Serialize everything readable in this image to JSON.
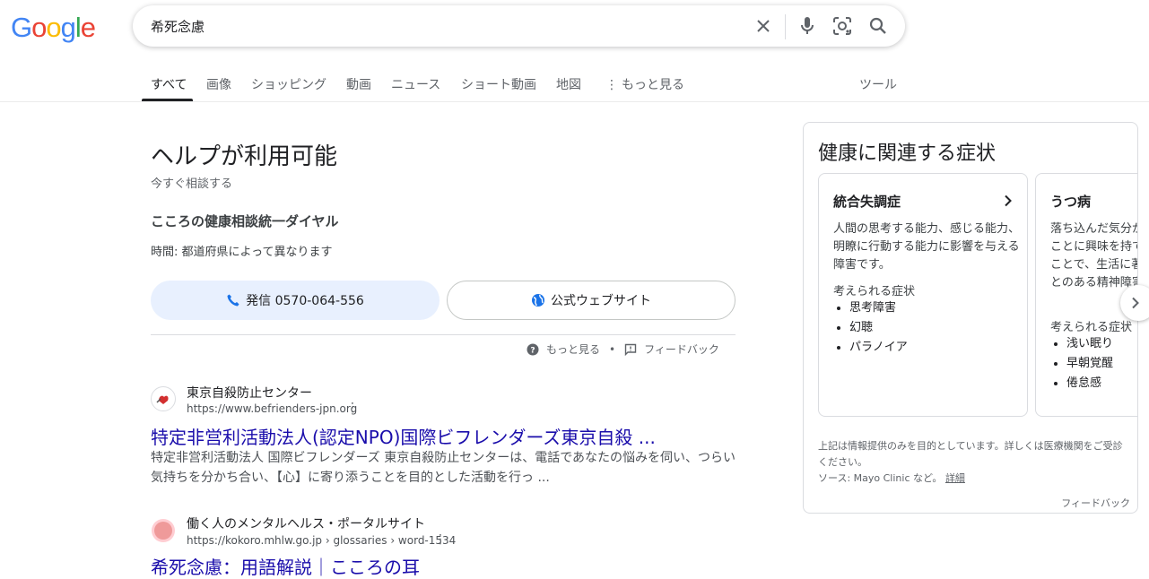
{
  "logo": {
    "letters": [
      "G",
      "o",
      "o",
      "g",
      "l",
      "e"
    ],
    "colors": [
      "#4285f4",
      "#ea4335",
      "#fbbc05",
      "#4285f4",
      "#34a853",
      "#ea4335"
    ]
  },
  "search": {
    "query": "希死念慮"
  },
  "tabs": [
    "すべて",
    "画像",
    "ショッピング",
    "動画",
    "ニュース",
    "ショート動画",
    "地図",
    "もっと見る",
    "ツール"
  ],
  "help": {
    "title": "ヘルプが利用可能",
    "subtitle": "今すぐ相談する",
    "hotline": "こころの健康相談統一ダイヤル",
    "hours_label": "時間",
    "hours_value": ": 都道府県によって異なります",
    "call_label": "発信 0570-064-556",
    "web_label": "公式ウェブサイト",
    "more_label": "もっと見る",
    "feedback_label": "フィードバック",
    "accent": "#1a73e8"
  },
  "results": [
    {
      "site": "東京自殺防止センター",
      "url": "https://www.befrienders-jpn.org",
      "title": "特定非営利活動法人(認定NPO)国際ビフレンダーズ東京自殺 ...",
      "snippet": "特定非営利活動法人 国際ビフレンダーズ 東京自殺防止センターは、電話であなたの悩みを伺い、つらい気持ちを分かち合い、【心】に寄り添うことを目的とした活動を行っ ..."
    },
    {
      "site": "働く人のメンタルヘルス・ポータルサイト",
      "url": "https://kokoro.mhlw.go.jp › glossaries › word-1534",
      "title": "希死念慮：用語解説｜こころの耳"
    }
  ],
  "knowledge_panel": {
    "title": "健康に関連する症状",
    "cards": [
      {
        "title": "統合失調症",
        "description": "人間の思考する能力、感じる能力、明瞭に行動する能力に影響を与える障害です。",
        "symptoms_label": "考えられる症状",
        "symptoms": [
          "思考障害",
          "幻聴",
          "パラノイア"
        ]
      },
      {
        "title": "うつ病",
        "description": "落ち込んだ気分が続き、身の回りのことに興味を持てなくなったりすることで、生活に著しい支障が出ることのある精神障害",
        "symptoms_label": "考えられる症状",
        "symptoms": [
          "浅い眠り",
          "早朝覚醒",
          "倦怠感"
        ]
      }
    ],
    "note": "上記は情報提供のみを目的としています。詳しくは医療機関をご受診ください。",
    "source": "ソース: Mayo Clinic など。",
    "details_link": "詳細",
    "feedback": "フィードバック"
  }
}
